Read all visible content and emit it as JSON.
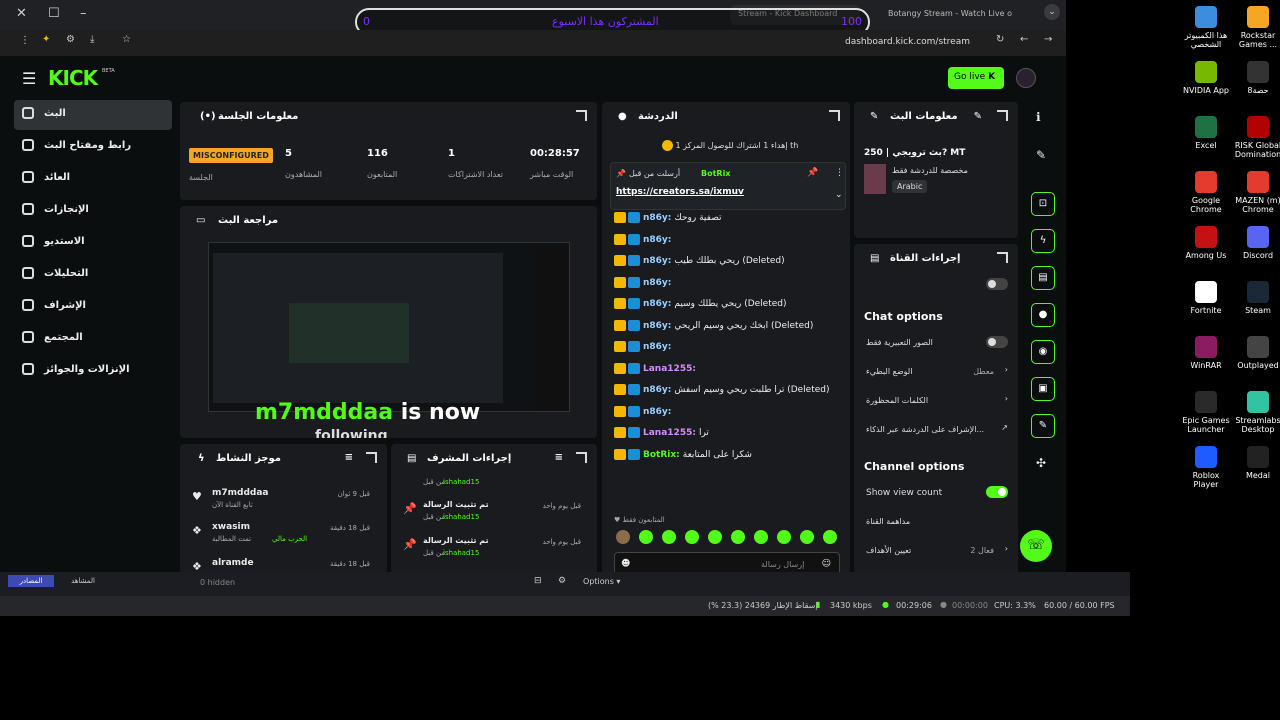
{
  "browser": {
    "tabs": [
      {
        "label": "Stream - Kick Dashboard"
      },
      {
        "label": "Botangy Stream - Watch Live o"
      }
    ],
    "url": "dashboard.kick.com/stream",
    "overlay": {
      "text": "المشتركون هذا الاسبوع",
      "left_value": "0",
      "right_value": "100"
    }
  },
  "topnav": {
    "logo": "KICK",
    "logo_sup": "BETA",
    "go_live": "Go live"
  },
  "sidebar": {
    "items": [
      {
        "label": "البث"
      },
      {
        "label": "رابط ومفتاح البث"
      },
      {
        "label": "العائد"
      },
      {
        "label": "الإنجازات"
      },
      {
        "label": "الاستديو"
      },
      {
        "label": "التحليلات"
      },
      {
        "label": "الإشراف"
      },
      {
        "label": "المجتمع"
      },
      {
        "label": "الإنزالات والجوائز"
      }
    ]
  },
  "session": {
    "title": "معلومات الجلسة",
    "status": "MISCONFIGURED",
    "status_label": "الجلسة",
    "stats": [
      {
        "value": "5",
        "label": "المشاهدون"
      },
      {
        "value": "116",
        "label": "المتابعون"
      },
      {
        "value": "1",
        "label": "تعداد الاشتراكات"
      },
      {
        "value": "00:28:57",
        "label": "الوقت مباشر"
      }
    ]
  },
  "preview": {
    "title": "مراجعة البث",
    "overlay_text": "m7mdddaa is now",
    "overlay_text2": "following"
  },
  "activity": {
    "title": "موجز النشاط",
    "items": [
      {
        "name": "m7mdddaa",
        "sub": "تابع القناة الآن",
        "time": "قبل 9 ثوان"
      },
      {
        "name": "xwasim",
        "sub": "تمت المطالبة",
        "sub2": "الحرب مالي",
        "time": "قبل 18 دقيقة"
      },
      {
        "name": "alramde",
        "sub": "",
        "time": "قبل 18 دقيقة"
      }
    ]
  },
  "modactions": {
    "title": "إجراءات المشرف",
    "items": [
      {
        "title": "",
        "by": "من قبل",
        "user": "ishahad15",
        "time": ""
      },
      {
        "title": "تم تثبيت الرسالة",
        "by": "من قبل",
        "user": "ishahad15",
        "time": "قبل يوم واحد"
      },
      {
        "title": "تم تثبيت الرسالة",
        "by": "من قبل",
        "user": "ishahad15",
        "time": "قبل يوم واحد"
      }
    ]
  },
  "chat": {
    "title": "الدردشة",
    "goal": "إهداء 1 اشتراك للوصول المركز 1",
    "goal_prefix": "th",
    "pinned_by": "أرسلت من قبل",
    "pinned_user": "BotRix",
    "pinned_link": "https://creators.sa/ixmuv",
    "messages": [
      {
        "user": "n86y:",
        "text": "تصفية روحك",
        "cls": ""
      },
      {
        "user": "n86y:",
        "text": "",
        "cls": ""
      },
      {
        "user": "n86y:",
        "text": "ريحي بطلك طيب (Deleted)",
        "cls": ""
      },
      {
        "user": "n86y:",
        "text": "",
        "cls": ""
      },
      {
        "user": "n86y:",
        "text": "ريحي يطلك وسيم (Deleted)",
        "cls": ""
      },
      {
        "user": "n86y:",
        "text": "ابخك ريحي وسيم الريحي (Deleted)",
        "cls": ""
      },
      {
        "user": "n86y:",
        "text": "",
        "cls": ""
      },
      {
        "user": "Lana1255:",
        "text": "",
        "cls": "p"
      },
      {
        "user": "n86y:",
        "text": "ترا طلبت ريحي وسيم اسفش (Deleted)",
        "cls": ""
      },
      {
        "user": "n86y:",
        "text": "",
        "cls": ""
      },
      {
        "user": "Lana1255:",
        "text": "ترا",
        "cls": "p"
      },
      {
        "user": "BotRix:",
        "text": "شكرا على المتابعة",
        "cls": "g"
      }
    ],
    "followers_only": "المتابعون فقط",
    "input_placeholder": "إرسال رسالة",
    "count": "0",
    "send_label": "الدردشة"
  },
  "streaminfo": {
    "title": "معلومات البث",
    "stream_title": "بث ترويجي | 250? MT",
    "category": "مخصصة للدردشة فقط",
    "language": "Arabic"
  },
  "channelactions": {
    "title": "إجراءات القناة",
    "chat_options_title": "Chat options",
    "chat_options": [
      {
        "label": "الصور التعبيرية فقط",
        "type": "toggle"
      },
      {
        "label": "الوضع البطيء",
        "value": "معطل",
        "type": "chevron"
      },
      {
        "label": "الكلمات المحظورة",
        "type": "chevron"
      },
      {
        "label": "الإشراف على الدردشة عبر الذكاء...",
        "type": "link"
      }
    ],
    "channel_options_title": "Channel options",
    "channel_options": [
      {
        "label": "Show view count",
        "type": "toggle_on"
      },
      {
        "label": "مداهمة القناة",
        "type": "none"
      },
      {
        "label": "تعيين الأهداف",
        "value": "فعال 2",
        "type": "chevron"
      }
    ]
  },
  "statusbar": {
    "hidden": "0 hidden",
    "options": "Options",
    "dropped": "إسقاط الإطار 24369 (23.3 %)",
    "kbps": "3430 kbps",
    "time1": "00:29:06",
    "time2": "00:00:00",
    "cpu": "CPU: 3.3%",
    "fps": "60.00 / 60.00 FPS",
    "btn1": "المصادر",
    "btn2": "المشاهد"
  },
  "desktop": {
    "icons": [
      {
        "label": "هذا الكمبيوتر الشخصي",
        "color": "#3b8ede"
      },
      {
        "label": "Rockstar Games ...",
        "color": "#f5a623"
      },
      {
        "label": "NVIDIA App",
        "color": "#76b900"
      },
      {
        "label": "8حصة",
        "color": "#333"
      },
      {
        "label": "Excel",
        "color": "#1e7145"
      },
      {
        "label": "RISK Global Domination",
        "color": "#b30000"
      },
      {
        "label": "Google Chrome",
        "color": "#e33b2e"
      },
      {
        "label": "MAZEN (m) Chrome",
        "color": "#e33b2e"
      },
      {
        "label": "Among Us",
        "color": "#c51111"
      },
      {
        "label": "Discord",
        "color": "#5865f2"
      },
      {
        "label": "Fortnite",
        "color": "#fff"
      },
      {
        "label": "Steam",
        "color": "#1b2838"
      },
      {
        "label": "WinRAR",
        "color": "#8b1c62"
      },
      {
        "label": "Outplayed",
        "color": "#444"
      },
      {
        "label": "Epic Games Launcher",
        "color": "#2a2a2a"
      },
      {
        "label": "Streamlabs Desktop",
        "color": "#31c3a2"
      },
      {
        "label": "Roblox Player",
        "color": "#1e5cff"
      },
      {
        "label": "Medal",
        "color": "#222"
      }
    ]
  }
}
